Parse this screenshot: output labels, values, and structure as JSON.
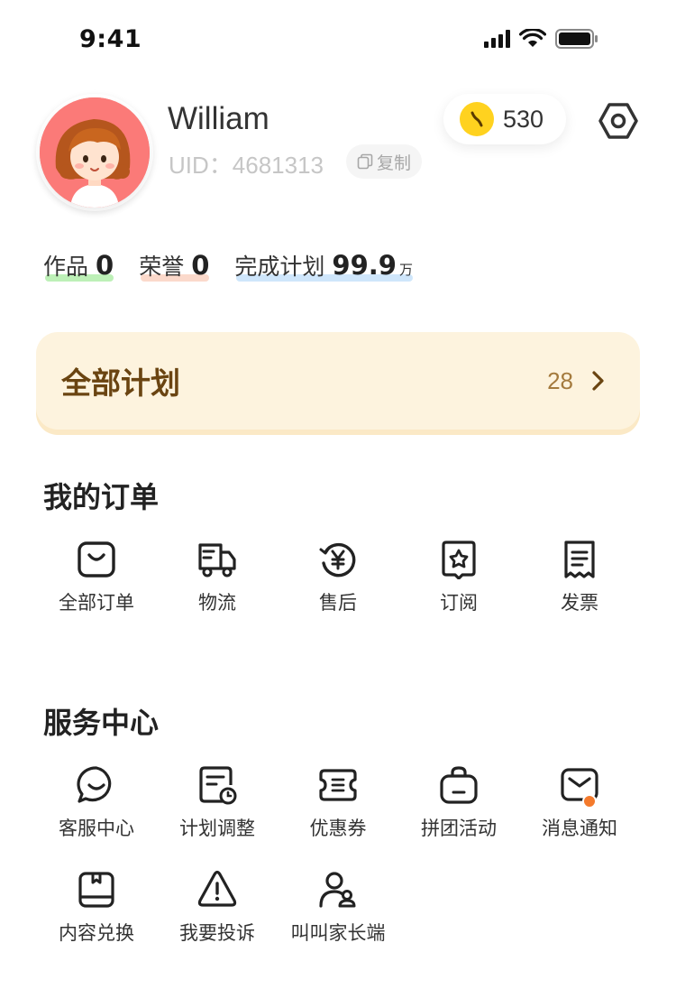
{
  "status_bar": {
    "time": "9:41"
  },
  "profile": {
    "name": "William",
    "uid_label": "UID：4681313",
    "copy_label": "复制",
    "coins": "530"
  },
  "stats": [
    {
      "label": "作品",
      "value": "0",
      "unit": "",
      "underline": "#bdf0b7"
    },
    {
      "label": "荣誉",
      "value": "0",
      "unit": "",
      "underline": "#fbd9cb"
    },
    {
      "label": "完成计划",
      "value": "99.9",
      "unit": "万",
      "underline": "#cfe6fb"
    }
  ],
  "plan_card": {
    "title": "全部计划",
    "count": "28"
  },
  "orders": {
    "title": "我的订单",
    "items": [
      {
        "icon": "shopping-bag-icon",
        "label": "全部订单"
      },
      {
        "icon": "truck-icon",
        "label": "物流"
      },
      {
        "icon": "yen-refund-icon",
        "label": "售后"
      },
      {
        "icon": "star-badge-icon",
        "label": "订阅"
      },
      {
        "icon": "receipt-icon",
        "label": "发票"
      }
    ]
  },
  "services": {
    "title": "服务中心",
    "items": [
      {
        "icon": "chat-bubble-icon",
        "label": "客服中心"
      },
      {
        "icon": "calendar-clock-icon",
        "label": "计划调整"
      },
      {
        "icon": "ticket-icon",
        "label": "优惠券"
      },
      {
        "icon": "group-bag-icon",
        "label": "拼团活动"
      },
      {
        "icon": "mail-icon",
        "label": "消息通知",
        "has_badge": true
      },
      {
        "icon": "package-box-icon",
        "label": "内容兑换"
      },
      {
        "icon": "warning-triangle-icon",
        "label": "我要投诉"
      },
      {
        "icon": "parent-child-icon",
        "label": "叫叫家长端"
      }
    ]
  },
  "colors": {
    "plan_card_bg": "#fdf3de",
    "plan_title": "#6a4411",
    "coin": "#ffd21f",
    "avatar_bg": "#fb7a78",
    "badge": "#f47a2c"
  }
}
